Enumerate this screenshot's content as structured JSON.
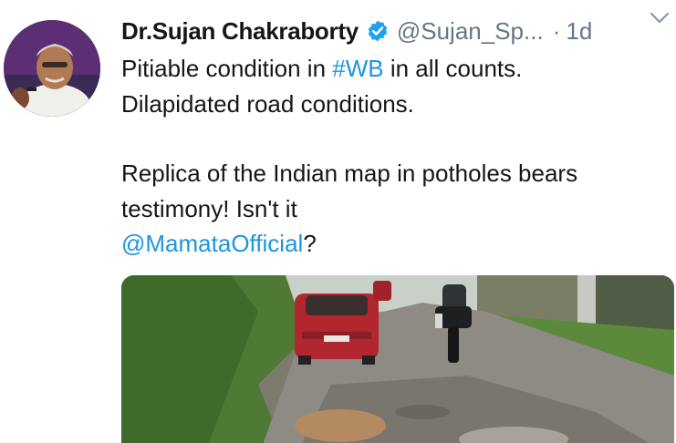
{
  "tweet": {
    "author": {
      "display_name": "Dr.Sujan Chakraborty",
      "handle": "@Sujan_Sp...",
      "verified": true,
      "avatar_icon": "profile-photo"
    },
    "separator": "·",
    "timestamp": "1d",
    "menu_icon": "chevron-down-icon",
    "text": {
      "line1_prefix": "Pitiable condition in ",
      "line1_hashtag": "#WB",
      "line1_suffix": " in all counts.",
      "line2": "Dilapidated road conditions.",
      "line3": "Replica of the Indian map in potholes bears",
      "line4": "testimony!  Isn't it",
      "mention": "@MamataOfficial",
      "mention_suffix": "?"
    },
    "media": {
      "type": "photo"
    }
  },
  "colors": {
    "text_primary": "#14171a",
    "text_secondary": "#657786",
    "link": "#1b95e0",
    "verified_badge": "#1da1f2"
  }
}
